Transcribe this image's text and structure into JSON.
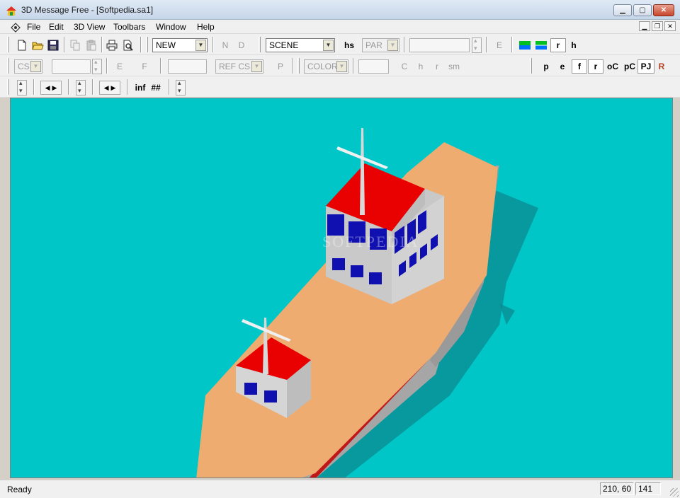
{
  "window": {
    "title": "3D Message Free - [Softpedia.sa1]"
  },
  "menu": {
    "items": [
      "File",
      "Edit",
      "3D View",
      "Toolbars",
      "Window",
      "Help"
    ]
  },
  "toolbar1": {
    "object_combo": "NEW",
    "n_label": "N",
    "d_label": "D",
    "scene_combo": "SCENE",
    "hs_label": "hs",
    "par_combo": "PAR",
    "e_label": "E",
    "r_label": "r",
    "h_label": "h"
  },
  "toolbar2": {
    "cs_combo": "CS",
    "e_label": "E",
    "f_label": "F",
    "refcs_combo": "REF CS",
    "p_label": "P",
    "color_combo": "COLOR",
    "c_label": "C",
    "h_label": "h",
    "r_label": "r",
    "sm_label": "sm",
    "right_buttons": [
      "p",
      "e",
      "f",
      "r",
      "oC",
      "pC",
      "PJ",
      "R"
    ]
  },
  "toolbar3": {
    "inf_label": "inf",
    "hash_label": "##"
  },
  "viewport": {
    "watermark": "SOFTPEDIA",
    "background": "#00c6c8"
  },
  "status": {
    "text": "Ready",
    "coords": "210, 60",
    "value": "141"
  }
}
